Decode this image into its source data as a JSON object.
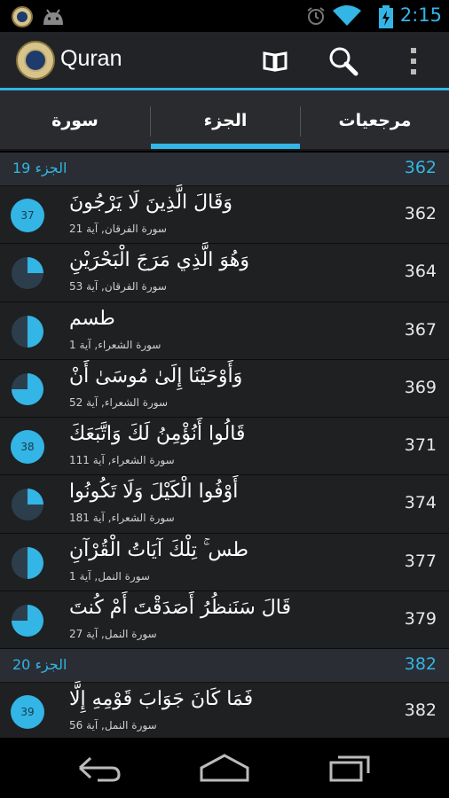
{
  "status_bar": {
    "time": "2:15",
    "icons": [
      "quran-notification-icon",
      "android-icon",
      "alarm-icon",
      "wifi-icon",
      "battery-charging-icon"
    ]
  },
  "action_bar": {
    "title": "Quran",
    "actions": [
      "book-icon",
      "search-icon",
      "overflow-menu-icon"
    ]
  },
  "tabs": [
    {
      "label": "سورة",
      "selected": false
    },
    {
      "label": "الجزء",
      "selected": true
    },
    {
      "label": "مرجعيات",
      "selected": false
    }
  ],
  "accent_color": "#33b5e5",
  "sections": [
    {
      "title": "الجزء 19",
      "page": "362",
      "rows": [
        {
          "ayah": "وَقَالَ الَّذِينَ لَا يَرْجُونَ",
          "sura": "سورة الفرقان, آية 21",
          "page": "362",
          "marker": "badge",
          "number": "37"
        },
        {
          "ayah": "وَهُوَ الَّذِي مَرَجَ الْبَحْرَيْنِ",
          "sura": "سورة الفرقان, آية 53",
          "page": "364",
          "marker": "quarter",
          "fraction": 0.25
        },
        {
          "ayah": "طسم",
          "sura": "سورة الشعراء, آية 1",
          "page": "367",
          "marker": "quarter",
          "fraction": 0.5
        },
        {
          "ayah": "وَأَوْحَيْنَا إِلَىٰ مُوسَىٰ أَنْ",
          "sura": "سورة الشعراء, آية 52",
          "page": "369",
          "marker": "quarter",
          "fraction": 0.75
        },
        {
          "ayah": "قَالُوا أَنُؤْمِنُ لَكَ وَاتَّبَعَكَ",
          "sura": "سورة الشعراء, آية 111",
          "page": "371",
          "marker": "badge",
          "number": "38"
        },
        {
          "ayah": "أَوْفُوا الْكَيْلَ وَلَا تَكُونُوا",
          "sura": "سورة الشعراء, آية 181",
          "page": "374",
          "marker": "quarter",
          "fraction": 0.25
        },
        {
          "ayah": "طس ۚ تِلْكَ آيَاتُ الْقُرْآنِ",
          "sura": "سورة النمل, آية 1",
          "page": "377",
          "marker": "quarter",
          "fraction": 0.5
        },
        {
          "ayah": "قَالَ سَنَنظُرُ أَصَدَقْتَ أَمْ كُنتَ",
          "sura": "سورة النمل, آية 27",
          "page": "379",
          "marker": "quarter",
          "fraction": 0.75
        }
      ]
    },
    {
      "title": "الجزء 20",
      "page": "382",
      "rows": [
        {
          "ayah": "فَمَا كَانَ جَوَابَ قَوْمِهِ إِلَّا",
          "sura": "سورة النمل, آية 56",
          "page": "382",
          "marker": "badge",
          "number": "39"
        }
      ]
    }
  ],
  "nav_bar": [
    "back-icon",
    "home-icon",
    "recent-apps-icon"
  ]
}
